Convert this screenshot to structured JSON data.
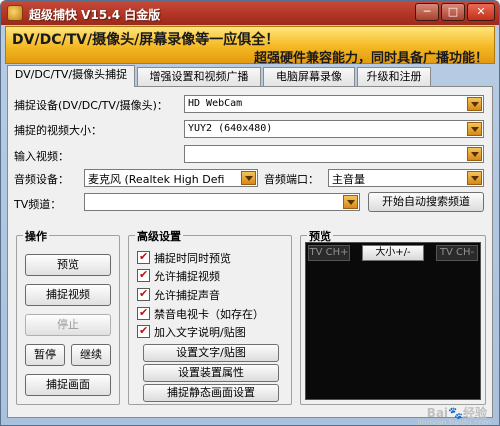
{
  "window": {
    "title": "超级捕快 V15.4 白金版",
    "min_label": "─",
    "max_label": "□",
    "close_label": "✕"
  },
  "banner": {
    "line1": "DV/DC/TV/摄像头/屏幕录像等一应俱全！",
    "line2": "超强硬件兼容能力，同时具备广播功能！"
  },
  "tabs": [
    {
      "label": "DV/DC/TV/摄像头捕捉",
      "active": true
    },
    {
      "label": "增强设置和视频广播",
      "active": false
    },
    {
      "label": "电脑屏幕录像",
      "active": false
    },
    {
      "label": "升级和注册",
      "active": false
    }
  ],
  "capture": {
    "device_label": "捕捉设备(DV/DC/TV/摄像头)：",
    "device_value": "HD WebCam",
    "size_label": "捕捉的视频大小：",
    "size_value": "YUY2 (640x480)",
    "input_label": "输入视频：",
    "input_value": "",
    "audio_label": "音频设备：",
    "audio_value": "麦克风 (Realtek High Defi",
    "audio_port_label": "音频端口：",
    "audio_port_value": "主音量",
    "tv_label": "TV频道：",
    "tv_value": "",
    "auto_search_label": "开始自动搜索频道"
  },
  "operations": {
    "title": "操作",
    "preview": "预览",
    "capture_video": "捕捉视频",
    "stop": "停止",
    "pause": "暂停",
    "resume": "继续",
    "capture_frame": "捕捉画面"
  },
  "advanced": {
    "title": "高级设置",
    "options": [
      {
        "label": "捕捉时同时预览",
        "checked": true
      },
      {
        "label": "允许捕捉视频",
        "checked": true
      },
      {
        "label": "允许捕捉声音",
        "checked": true
      },
      {
        "label": "禁音电视卡（如存在）",
        "checked": true
      },
      {
        "label": "加入文字说明/贴图",
        "checked": true
      }
    ],
    "set_text_btn": "设置文字/贴图",
    "device_props_btn": "设置装置属性",
    "still_settings_btn": "捕捉静态画面设置"
  },
  "preview": {
    "title": "预览",
    "tv_ch_plus": "TV CH+",
    "size_btn": "大小+/-",
    "tv_ch_minus": "TV CH-"
  },
  "watermark": {
    "text": "Bai🐾经验",
    "sub": "jingyan.baidu.com"
  }
}
